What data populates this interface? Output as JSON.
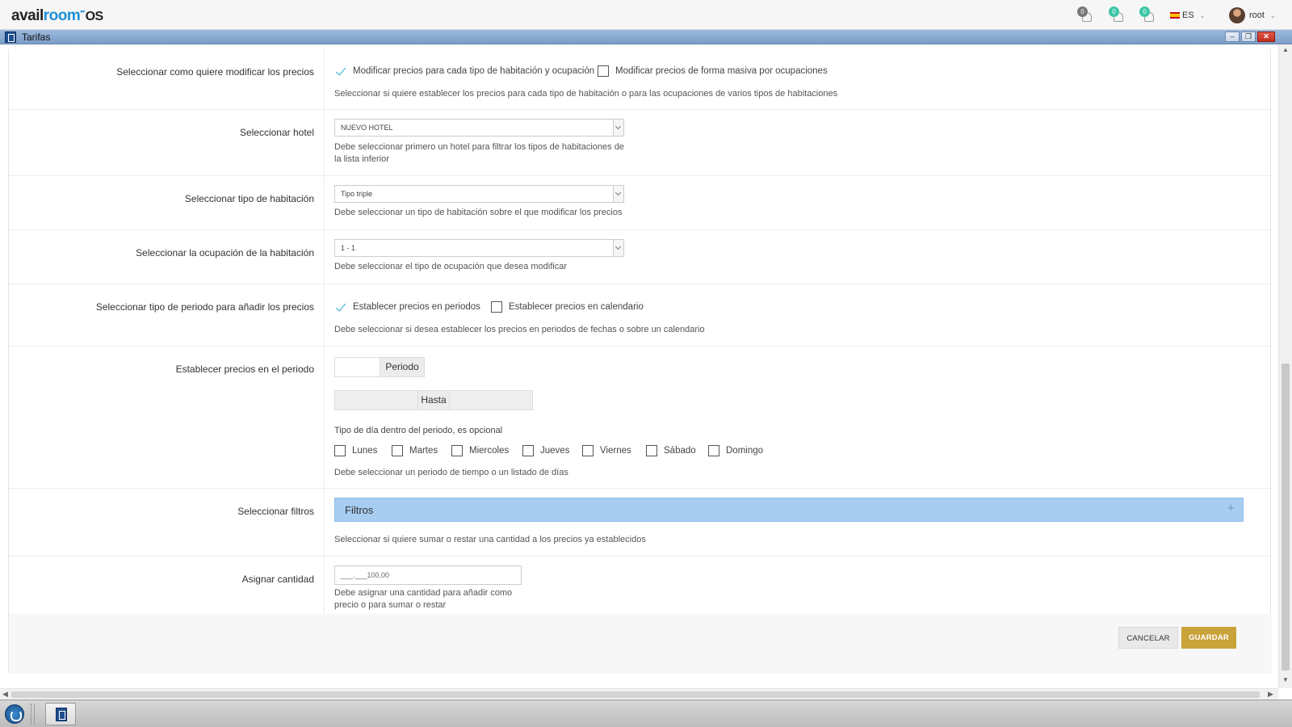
{
  "app": {
    "logo_part1": "avail",
    "logo_part2": "room",
    "logo_os": "OS"
  },
  "header": {
    "notifications": [
      {
        "icon": "bell-icon",
        "count": "0",
        "color": "#777777"
      },
      {
        "icon": "bell-icon",
        "count": "0",
        "color": "#3cc6a8"
      },
      {
        "icon": "bell-icon",
        "count": "0",
        "color": "#3cc6a8"
      }
    ],
    "language": "ES",
    "user": "root"
  },
  "window": {
    "title": "Tarifas",
    "minimize": "–",
    "restore": "❐",
    "close": "✕"
  },
  "form": {
    "modify_mode": {
      "label": "Seleccionar como quiere modificar los precios",
      "option1": "Modificar precios para cada tipo de habitación y ocupación",
      "option1_checked": true,
      "option2": "Modificar precios de forma masiva por ocupaciones",
      "option2_checked": false,
      "help": "Seleccionar si quiere establecer los precios para cada tipo de habitación o para las ocupaciones de varios tipos de habitaciones"
    },
    "hotel": {
      "label": "Seleccionar hotel",
      "value": "NUEVO HOTEL",
      "help": "Debe seleccionar primero un hotel para filtrar los tipos de habitaciones de la lista inferior"
    },
    "room_type": {
      "label": "Seleccionar tipo de habitación",
      "value": "Tipo triple",
      "help": "Debe seleccionar un tipo de habitación sobre el que modificar los precios"
    },
    "occupancy": {
      "label": "Seleccionar la ocupación de la habitación",
      "value": "1 - 1",
      "help": "Debe seleccionar el tipo de ocupación que desea modificar"
    },
    "period_type": {
      "label": "Seleccionar tipo de periodo para añadir los precios",
      "option1": "Establecer precios en periodos",
      "option1_checked": true,
      "option2": "Establecer precios en calendario",
      "option2_checked": false,
      "help": "Debe seleccionar si desea establecer los precios en periodos de fechas o sobre un calendario"
    },
    "period": {
      "label": "Establecer precios en el periodo",
      "period_addon": "Periodo",
      "until_addon": "Hasta",
      "days_label": "Tipo de día dentro del periodo, es opcional",
      "days": [
        "Lunes",
        "Martes",
        "Miercoles",
        "Jueves",
        "Viernes",
        "Sábado",
        "Domingo"
      ],
      "help": "Debe seleccionar un periodo de tiempo o un listado de días"
    },
    "filters": {
      "label": "Seleccionar filtros",
      "panel_title": "Filtros",
      "panel_toggle": "+",
      "help": "Seleccionar si quiere sumar o restar una cantidad a los precios ya establecidos"
    },
    "amount": {
      "label": "Asignar cantidad",
      "value": "___.___100,00",
      "help": "Debe asignar una cantidad para añadir como precio o para sumar o restar"
    }
  },
  "actions": {
    "cancel": "CANCELAR",
    "save": "GUARDAR"
  },
  "colors": {
    "accent": "#2ca8d8",
    "save_button": "#c9a23a",
    "panel": "#a7cdf0",
    "title_bar": "#8aabd3"
  }
}
